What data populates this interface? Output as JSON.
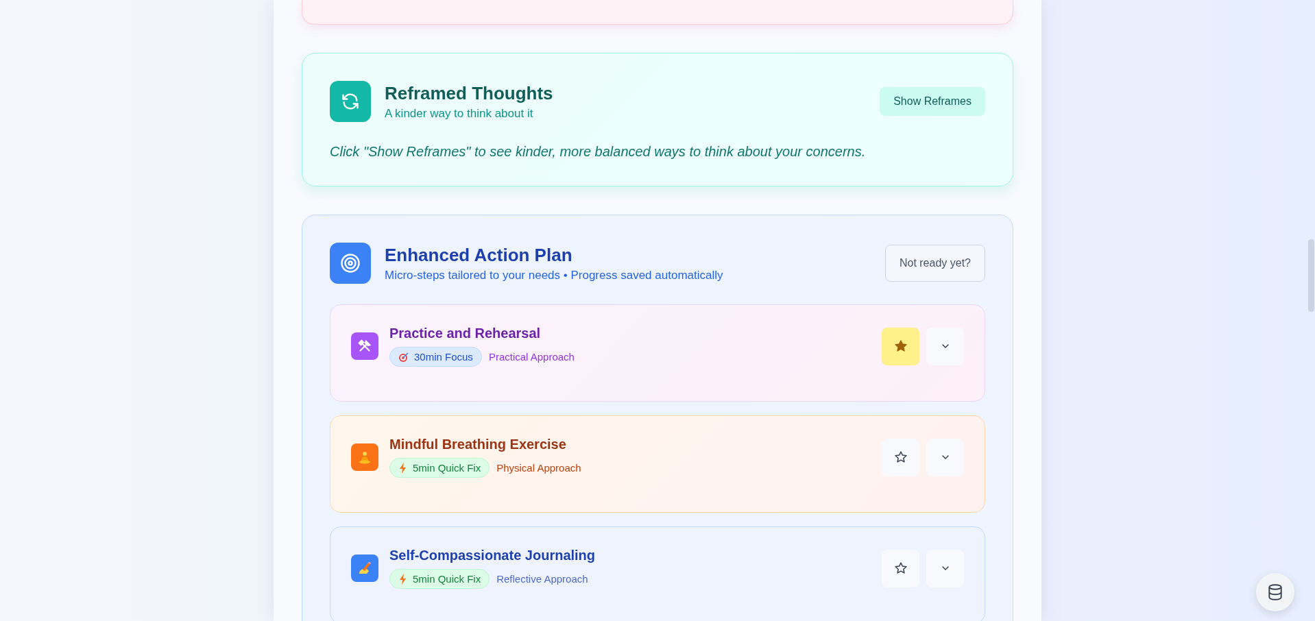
{
  "reframe_card": {
    "title": "Reframed Thoughts",
    "subtitle": "A kinder way to think about it",
    "button": "Show Reframes",
    "hint": "Click \"Show Reframes\" to see kinder, more balanced ways to think about your concerns."
  },
  "action_plan": {
    "title": "Enhanced Action Plan",
    "subtitle": "Micro-steps tailored to your needs • Progress saved automatically",
    "button": "Not ready yet?",
    "steps": [
      {
        "kind": "practice",
        "title": "Practice and Rehearsal",
        "badge": {
          "kind": "focus",
          "label": "30min Focus"
        },
        "approach": "Practical Approach",
        "starred": true
      },
      {
        "kind": "breathing",
        "title": "Mindful Breathing Exercise",
        "badge": {
          "kind": "quick",
          "label": "5min Quick Fix"
        },
        "approach": "Physical Approach",
        "starred": false
      },
      {
        "kind": "journaling",
        "title": "Self-Compassionate Journaling",
        "badge": {
          "kind": "quick",
          "label": "5min Quick Fix"
        },
        "approach": "Reflective Approach",
        "starred": false
      }
    ]
  }
}
